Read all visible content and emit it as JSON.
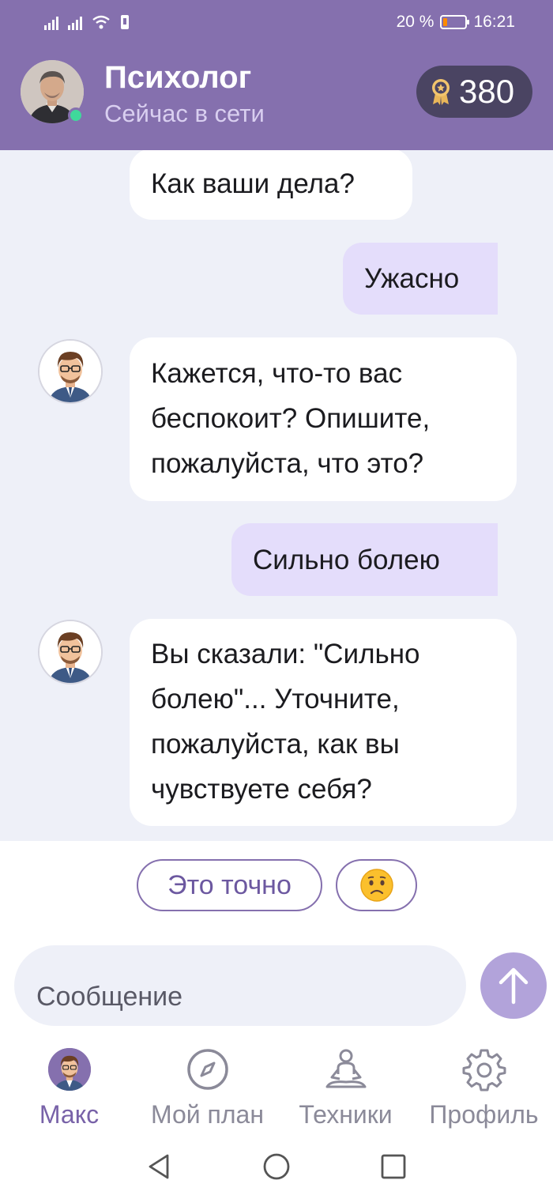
{
  "status_bar": {
    "battery_text": "20 %",
    "battery_level": 0.2,
    "time": "16:21"
  },
  "header": {
    "title": "Психолог",
    "subtitle": "Сейчас в сети",
    "points": "380",
    "points_icon": "medal-star-icon"
  },
  "messages": [
    {
      "from": "bot",
      "text": "Как ваши дела?"
    },
    {
      "from": "user",
      "text": "Ужасно"
    },
    {
      "from": "bot",
      "lines": [
        "Кажется, что-то вас",
        "беспокоит? Опишите,",
        "пожалуйста, что это?"
      ]
    },
    {
      "from": "user",
      "text": "Сильно болею"
    },
    {
      "from": "bot",
      "lines": [
        "Вы сказали: \"Сильно",
        "болею\"... Уточните,",
        "пожалуйста, как вы",
        "чувствуете себя?"
      ]
    }
  ],
  "quick_replies": {
    "first": "Это точно",
    "second_icon": "sad-face-emoji"
  },
  "composer": {
    "placeholder": "Сообщение",
    "send_icon": "arrow-up-icon"
  },
  "bottom_nav": [
    {
      "label": "Макс",
      "icon": "avatar-icon",
      "active": true
    },
    {
      "label": "Мой план",
      "icon": "compass-icon"
    },
    {
      "label": "Техники",
      "icon": "meditation-icon"
    },
    {
      "label": "Профиль",
      "icon": "gear-icon"
    }
  ],
  "colors": {
    "accent": "#8570ae",
    "user_bubble": "#e4ddfb",
    "background": "#eef0f8",
    "online": "#3fd99b"
  }
}
